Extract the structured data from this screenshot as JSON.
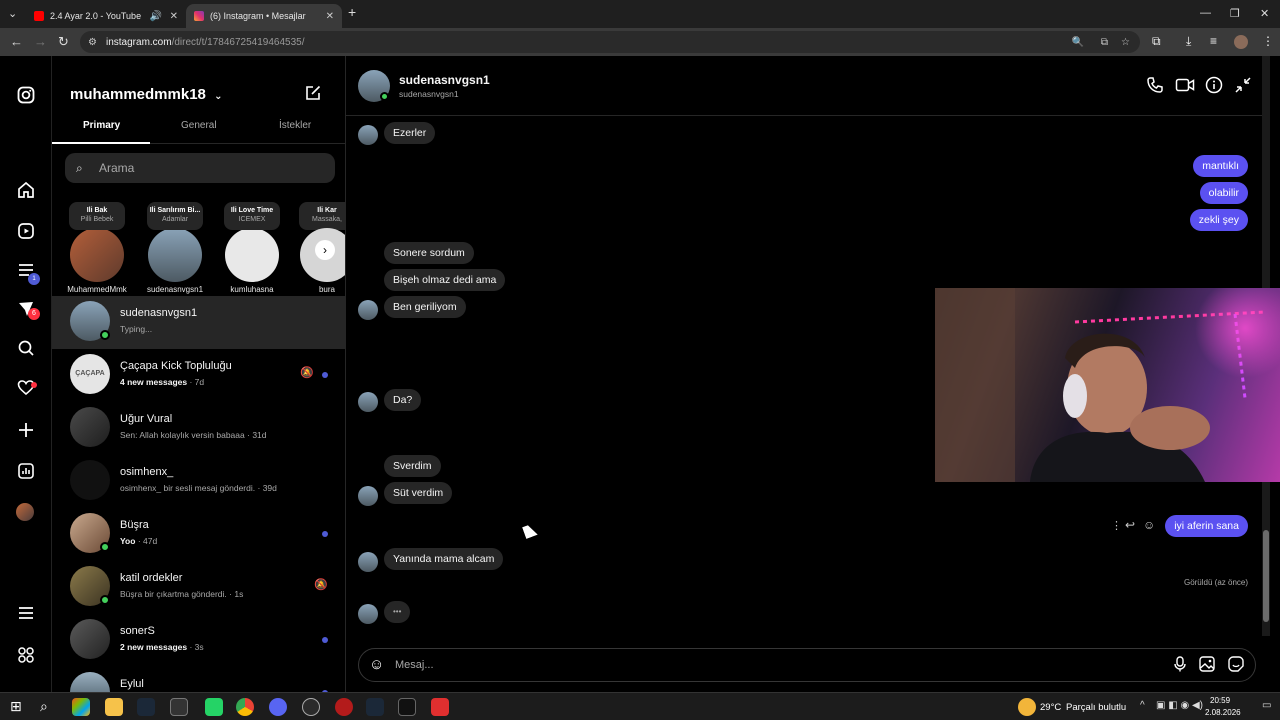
{
  "browser": {
    "tabs": [
      {
        "label": "2.4 Ayar 2.0 - YouTube",
        "icon": "youtube-icon"
      },
      {
        "label": "(6) Instagram • Mesajlar",
        "icon": "instagram-icon"
      }
    ],
    "url_main": "instagram.com",
    "url_rest": "/direct/t/17846725419464535/"
  },
  "left_rail": {
    "icons": [
      "instagram-icon",
      "home-icon",
      "reels-icon",
      "explore-icon",
      "messages-icon",
      "search-icon",
      "heart-icon",
      "create-icon",
      "dashboard-icon",
      "profile-icon",
      "menu-icon",
      "more-icon"
    ],
    "messages_badge": "6"
  },
  "sidebar": {
    "account": "muhammedmmk18",
    "tabs": [
      "Primary",
      "General",
      "İstekler"
    ],
    "search_placeholder": "Arama",
    "notes": [
      {
        "title": "Ili Bak",
        "sub": "Pilli Bebek",
        "name": "MuhammedMmk"
      },
      {
        "title": "Ili Sarılırım Bi...",
        "sub": "Adamlar",
        "name": "sudenasnvgsn1"
      },
      {
        "title": "Ili Love Time",
        "sub": "ICEMEX",
        "name": "kumluhasna"
      },
      {
        "title": "Ili Kar",
        "sub": "Massaka,",
        "name": "bura"
      }
    ],
    "conversations": [
      {
        "name": "sudenasnvgsn1",
        "sub": "Typing...",
        "time": "",
        "unread": false,
        "muted": false,
        "online": true
      },
      {
        "name": "Çaçapa Kick Topluluğu",
        "sub": "4 new messages",
        "time": "· 7d",
        "unread": true,
        "muted": true,
        "online": false
      },
      {
        "name": "Uğur Vural",
        "sub": "Sen: Allah kolaylık versin babaaa",
        "time": "· 31d",
        "unread": false,
        "muted": false,
        "online": false
      },
      {
        "name": "osimhenx_",
        "sub": "osimhenx_ bir sesli mesaj gönderdi.",
        "time": "· 39d",
        "unread": false,
        "muted": false,
        "online": false
      },
      {
        "name": "Büşra",
        "sub": "Yoo",
        "time": "· 47d",
        "unread": true,
        "muted": false,
        "online": true
      },
      {
        "name": "katil ordekler",
        "sub": "Büşra bir çıkartma gönderdi.",
        "time": "· 1s",
        "unread": false,
        "muted": true,
        "online": true
      },
      {
        "name": "sonerS",
        "sub": "2 new messages",
        "time": "· 3s",
        "unread": true,
        "muted": false,
        "online": false
      },
      {
        "name": "Eylul",
        "sub": "",
        "time": "",
        "unread": true,
        "muted": false,
        "online": false
      }
    ]
  },
  "chat": {
    "name": "sudenasnvgsn1",
    "username": "sudenasnvgsn1",
    "messages": [
      {
        "side": "left",
        "text": "Ezerler"
      },
      {
        "side": "right",
        "text": "mantıklı"
      },
      {
        "side": "right",
        "text": "olabilir"
      },
      {
        "side": "right",
        "text": "zekli şey"
      },
      {
        "side": "left",
        "text": "Sonere sordum"
      },
      {
        "side": "left",
        "text": "Bişeh olmaz dedi ama"
      },
      {
        "side": "left",
        "text": "Ben geriliyom"
      },
      {
        "side": "left",
        "text": "Da?"
      },
      {
        "side": "left",
        "text": "Sverdim"
      },
      {
        "side": "left",
        "text": "Süt verdim"
      },
      {
        "side": "right",
        "text": "iyi aferin sana"
      },
      {
        "side": "left",
        "text": "Yanında mama alcam"
      },
      {
        "side": "left",
        "text": "•••"
      }
    ],
    "seen": "Görüldü (az önce)",
    "composer_placeholder": "Mesaj..."
  },
  "taskbar": {
    "weather_temp": "29°C",
    "weather_text": "Parçalı bulutlu",
    "time": "20:59",
    "date": "2.08.2026"
  }
}
